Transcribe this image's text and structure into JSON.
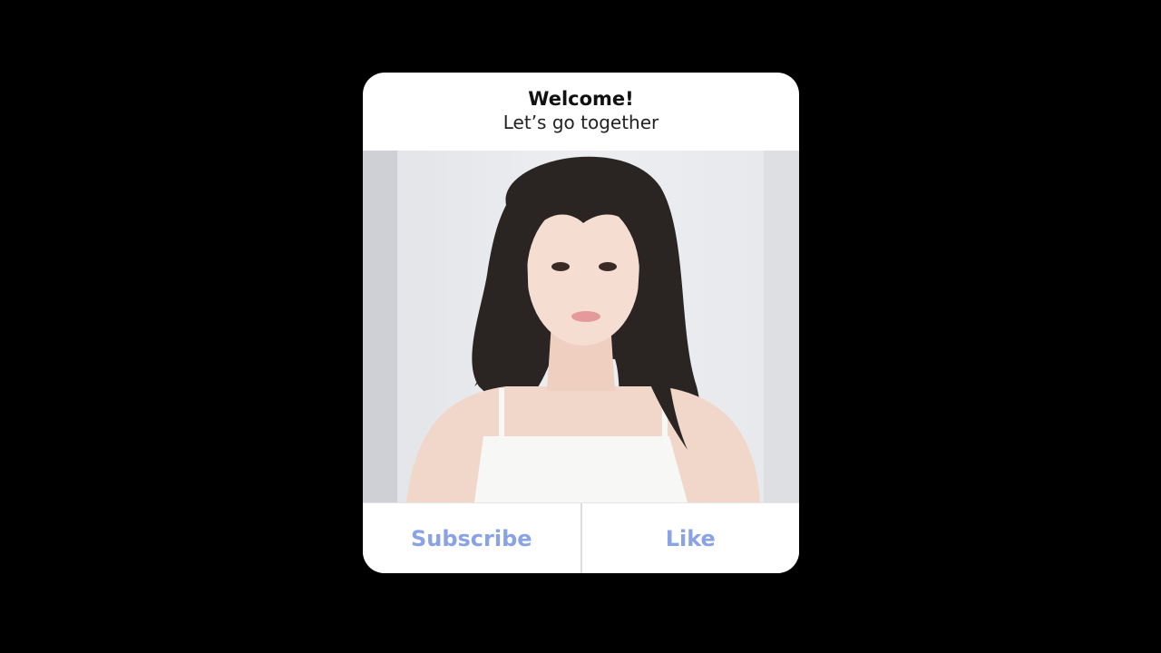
{
  "dialog": {
    "title": "Welcome!",
    "subtitle": "Let’s go together",
    "photo": {
      "description_icon": "portrait-photo",
      "alt": ""
    },
    "buttons": {
      "subscribe_label": "Subscribe",
      "like_label": "Like"
    }
  },
  "colors": {
    "background": "#000000",
    "card": "#ffffff",
    "button_text": "#8aa2e6",
    "divider": "#dcdcdc"
  }
}
